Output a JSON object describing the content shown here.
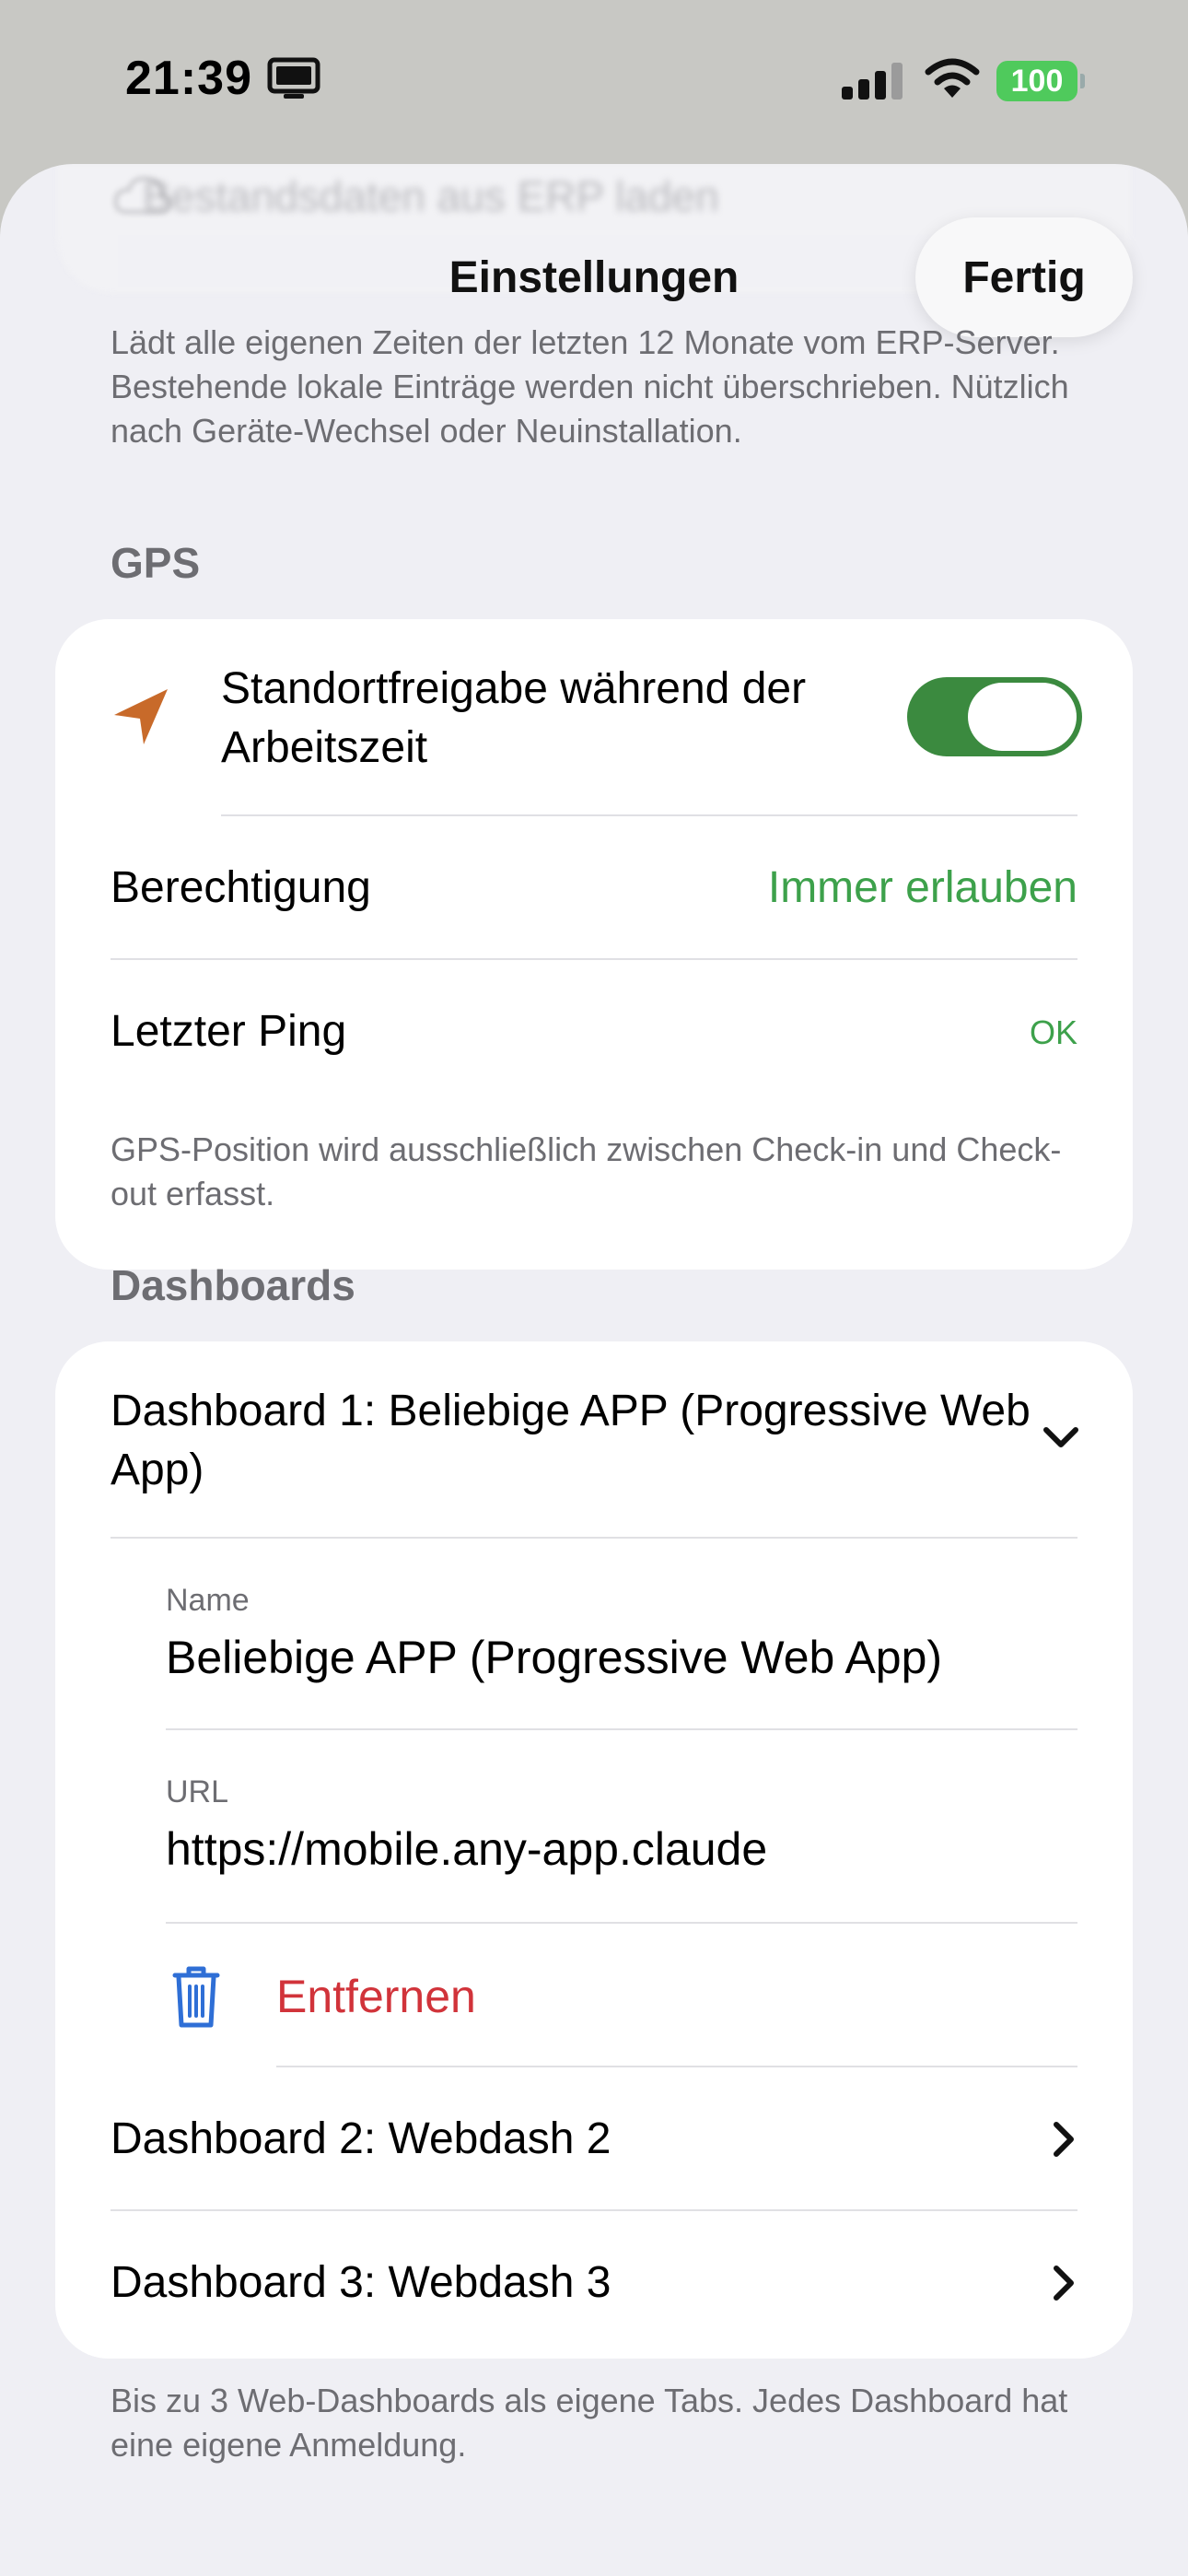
{
  "status_bar": {
    "time": "21:39",
    "battery": "100",
    "icons": [
      "screen-mirroring-icon",
      "cellular-signal-icon",
      "wifi-icon",
      "battery-icon"
    ]
  },
  "nav": {
    "title": "Einstellungen",
    "done_label": "Fertig",
    "ghost_row_label": "Bestandsdaten aus ERP laden"
  },
  "erp_footnote": "Lädt alle eigenen Zeiten der letzten 12 Monate vom ERP-Server. Bestehende lokale Einträge werden nicht überschrieben. Nützlich nach Geräte-Wechsel oder Neuinstallation.",
  "gps": {
    "header": "GPS",
    "location_label": "Standortfreigabe während der Arbeitszeit",
    "location_enabled": true,
    "permission_label": "Berechtigung",
    "permission_value": "Immer erlauben",
    "last_ping_label": "Letzter Ping",
    "last_ping_value": "OK",
    "footnote": "GPS-Position wird ausschließlich zwischen Check-in und Check-out erfasst."
  },
  "dashboards": {
    "header": "Dashboards",
    "items": [
      {
        "title": "Dashboard 1: Beliebige APP (Progressive Web App)",
        "expanded": true,
        "name_caption": "Name",
        "name_value": "Beliebige APP (Progressive Web App)",
        "url_caption": "URL",
        "url_value": "https://mobile.any-app.claude",
        "remove_label": "Entfernen"
      },
      {
        "title": "Dashboard 2: Webdash 2",
        "expanded": false
      },
      {
        "title": "Dashboard 3: Webdash 3",
        "expanded": false
      }
    ],
    "footnote": "Bis zu 3 Web-Dashboards als eigene Tabs. Jedes Dashboard hat eine eigene Anmeldung."
  },
  "colors": {
    "accent_green": "#3da14b",
    "toggle_on": "#3b8a3f",
    "destructive_red": "#d1333a",
    "location_icon": "#c86a2a",
    "trash_icon": "#2f6fd6"
  }
}
